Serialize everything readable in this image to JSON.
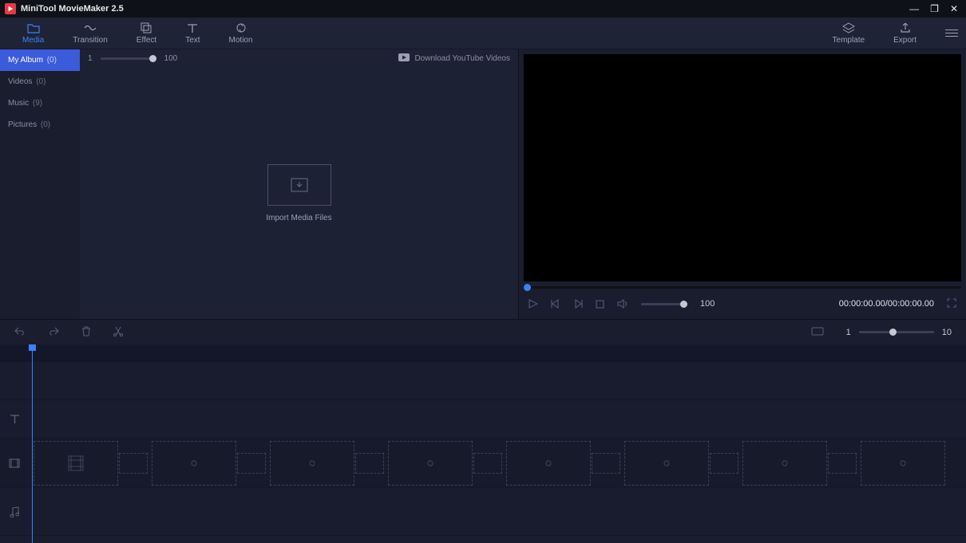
{
  "app": {
    "title": "MiniTool MovieMaker 2.5"
  },
  "toolbar": {
    "tabs": [
      {
        "label": "Media",
        "icon": "folder"
      },
      {
        "label": "Transition",
        "icon": "transition"
      },
      {
        "label": "Effect",
        "icon": "effect"
      },
      {
        "label": "Text",
        "icon": "text"
      },
      {
        "label": "Motion",
        "icon": "motion"
      }
    ],
    "right": [
      {
        "label": "Template",
        "icon": "template"
      },
      {
        "label": "Export",
        "icon": "export"
      }
    ]
  },
  "sidebar": {
    "items": [
      {
        "label": "My Album",
        "count": "(0)"
      },
      {
        "label": "Videos",
        "count": "(0)"
      },
      {
        "label": "Music",
        "count": "(9)"
      },
      {
        "label": "Pictures",
        "count": "(0)"
      }
    ]
  },
  "media": {
    "thumb_min": "1",
    "thumb_max": "100",
    "download_label": "Download YouTube Videos",
    "import_label": "Import Media Files"
  },
  "preview": {
    "volume": "100",
    "timecode": "00:00:00.00/00:00:00.00"
  },
  "timeline": {
    "zoom_min": "1",
    "zoom_max": "10"
  }
}
